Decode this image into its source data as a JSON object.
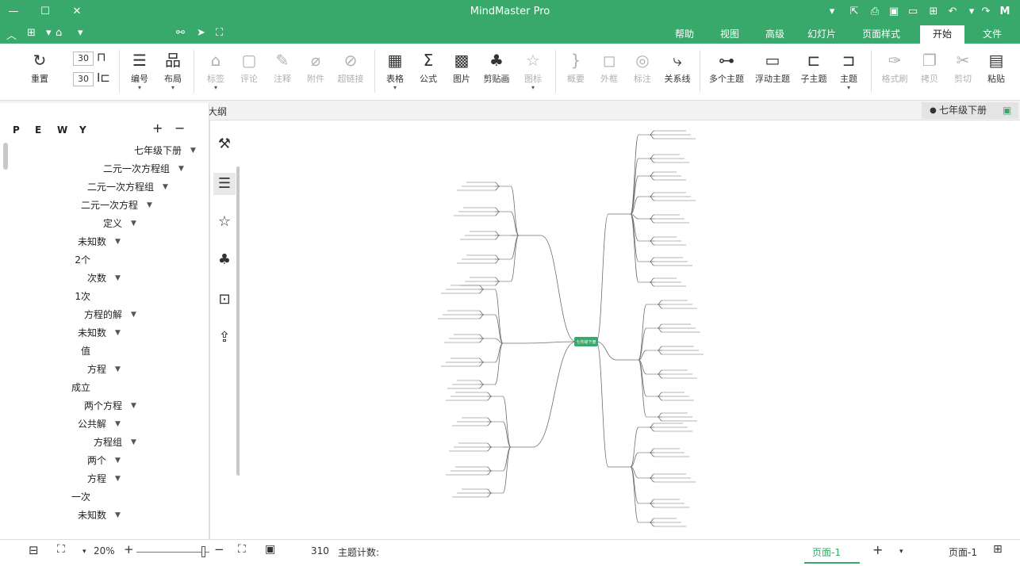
{
  "app": {
    "title": "MindMaster Pro",
    "accent": "#39a96b"
  },
  "menu": {
    "tabs": [
      "文件",
      "开始",
      "页面样式",
      "幻灯片",
      "高级",
      "视图",
      "帮助"
    ],
    "active": "开始"
  },
  "ribbon": {
    "paste": "粘贴",
    "cut": "剪切",
    "copy": "拷贝",
    "format_painter": "格式刷",
    "topic": "主题",
    "subtopic": "子主题",
    "floating_topic": "浮动主题",
    "multiple_topics": "多个主题",
    "relationship": "关系线",
    "callout": "标注",
    "boundary": "外框",
    "summary": "概要",
    "icon": "图标",
    "clipart": "剪贴画",
    "image": "图片",
    "formula": "公式",
    "table": "表格",
    "hyperlink": "超链接",
    "attachment": "附件",
    "note": "注释",
    "comment": "评论",
    "tag": "标签",
    "layout": "布局",
    "numbering": "编号",
    "spacing_h": "30",
    "spacing_v": "30",
    "reset": "重置"
  },
  "document": {
    "tab_name": "七年级下册"
  },
  "outline": {
    "header": "大纲",
    "tools": [
      "P",
      "E",
      "W",
      "Y",
      "+",
      "−"
    ],
    "items": [
      {
        "label": "七年级下册",
        "level": 0
      },
      {
        "label": "二元一次方程组",
        "level": 1
      },
      {
        "label": "二元一次方程组",
        "level": 2
      },
      {
        "label": "二元一次方程",
        "level": 3
      },
      {
        "label": "定义",
        "level": 4
      },
      {
        "label": "未知数",
        "level": 5
      },
      {
        "label": "2个",
        "level": 6
      },
      {
        "label": "次数",
        "level": 5
      },
      {
        "label": "1次",
        "level": 6
      },
      {
        "label": "方程的解",
        "level": 4
      },
      {
        "label": "未知数",
        "level": 5
      },
      {
        "label": "值",
        "level": 6
      },
      {
        "label": "方程",
        "level": 5
      },
      {
        "label": "成立",
        "level": 6
      },
      {
        "label": "两个方程",
        "level": 4
      },
      {
        "label": "公共解",
        "level": 5
      },
      {
        "label": "方程组",
        "level": 4
      },
      {
        "label": "两个",
        "level": 5
      },
      {
        "label": "方程",
        "level": 5
      },
      {
        "label": "一次",
        "level": 6
      },
      {
        "label": "未知数",
        "level": 5
      }
    ]
  },
  "canvas": {
    "root": "七年级下册"
  },
  "status": {
    "page_name": "页面-1",
    "page_tab": "页面-1",
    "topic_count_label": "主题计数:",
    "topic_count": "310",
    "zoom": "20%"
  }
}
